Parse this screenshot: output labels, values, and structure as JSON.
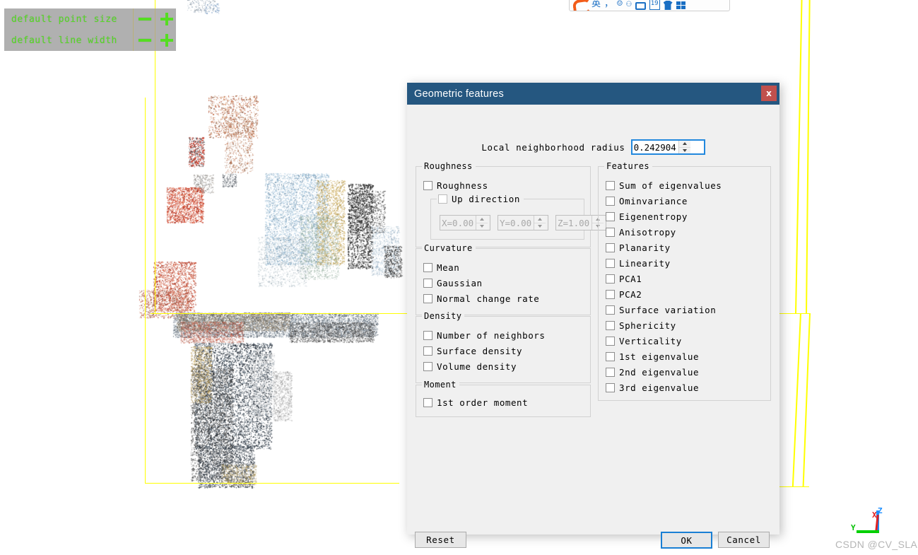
{
  "app": {
    "watermark": "CSDN @CV_SLAM"
  },
  "viewport": {
    "overlay": {
      "rows": [
        {
          "label": "default point size",
          "minus_icon": "minus-icon",
          "plus_icon": "plus-icon"
        },
        {
          "label": "default line width",
          "minus_icon": "minus-icon",
          "plus_icon": "plus-icon"
        }
      ]
    },
    "axis_gizmo": {
      "x_label": "X",
      "y_label": "Y",
      "z_label": "Z",
      "x_color": "#e02020",
      "y_color": "#00c000",
      "z_color": "#1e90ff"
    },
    "bbox_color": "#ffff00",
    "background_color": "#ffffff"
  },
  "ime_toolbar": {
    "icons": [
      "sogou-logo-icon",
      "chinese-english-toggle-icon",
      "comma-punctuation-icon",
      "emoji-icon",
      "microphone-icon",
      "keyboard-icon",
      "calendar-icon",
      "skin-icon",
      "apps-grid-icon"
    ],
    "labels": {
      "lang": "英",
      "punct": "，",
      "emoji": "☺",
      "mic": "🎙",
      "calendar": "19"
    }
  },
  "dialog": {
    "title": "Geometric features",
    "close_label": "x",
    "title_bg": "#255780",
    "close_bg": "#c0504d",
    "radius": {
      "label": "Local neighborhood radius",
      "value": "0.242904"
    },
    "groups": {
      "roughness": {
        "title": "Roughness",
        "items": [
          {
            "label": "Roughness",
            "checked": false
          }
        ],
        "up_direction": {
          "label": "Up direction",
          "checked": false,
          "enabled": false,
          "fields": [
            {
              "name": "x",
              "value": "X=0.00"
            },
            {
              "name": "y",
              "value": "Y=0.00"
            },
            {
              "name": "z",
              "value": "Z=1.00"
            }
          ]
        }
      },
      "curvature": {
        "title": "Curvature",
        "items": [
          {
            "label": "Mean",
            "checked": false
          },
          {
            "label": "Gaussian",
            "checked": false
          },
          {
            "label": "Normal change rate",
            "checked": false
          }
        ]
      },
      "density": {
        "title": "Density",
        "items": [
          {
            "label": "Number of neighbors",
            "checked": false
          },
          {
            "label": "Surface density",
            "checked": false
          },
          {
            "label": "Volume density",
            "checked": false
          }
        ]
      },
      "moment": {
        "title": "Moment",
        "items": [
          {
            "label": "1st order moment",
            "checked": false
          }
        ]
      },
      "features": {
        "title": "Features",
        "items": [
          {
            "label": "Sum of eigenvalues",
            "checked": false
          },
          {
            "label": "Ominvariance",
            "checked": false
          },
          {
            "label": "Eigenentropy",
            "checked": false
          },
          {
            "label": "Anisotropy",
            "checked": false
          },
          {
            "label": "Planarity",
            "checked": false
          },
          {
            "label": "Linearity",
            "checked": false
          },
          {
            "label": "PCA1",
            "checked": false
          },
          {
            "label": "PCA2",
            "checked": false
          },
          {
            "label": "Surface variation",
            "checked": false
          },
          {
            "label": "Sphericity",
            "checked": false
          },
          {
            "label": "Verticality",
            "checked": false
          },
          {
            "label": "1st eigenvalue",
            "checked": false
          },
          {
            "label": "2nd eigenvalue",
            "checked": false
          },
          {
            "label": "3rd eigenvalue",
            "checked": false
          }
        ]
      }
    },
    "buttons": {
      "reset": "Reset",
      "ok": "OK",
      "cancel": "Cancel",
      "focus_color": "#1a7fd4"
    }
  }
}
